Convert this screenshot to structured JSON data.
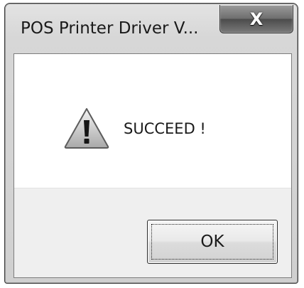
{
  "window": {
    "title": "POS Printer Driver V..."
  },
  "titlebar": {
    "close_glyph": "X",
    "close_icon": "close-icon"
  },
  "message": {
    "icon": "warning-icon",
    "text": "SUCCEED !"
  },
  "buttons": {
    "ok_label": "OK"
  }
}
